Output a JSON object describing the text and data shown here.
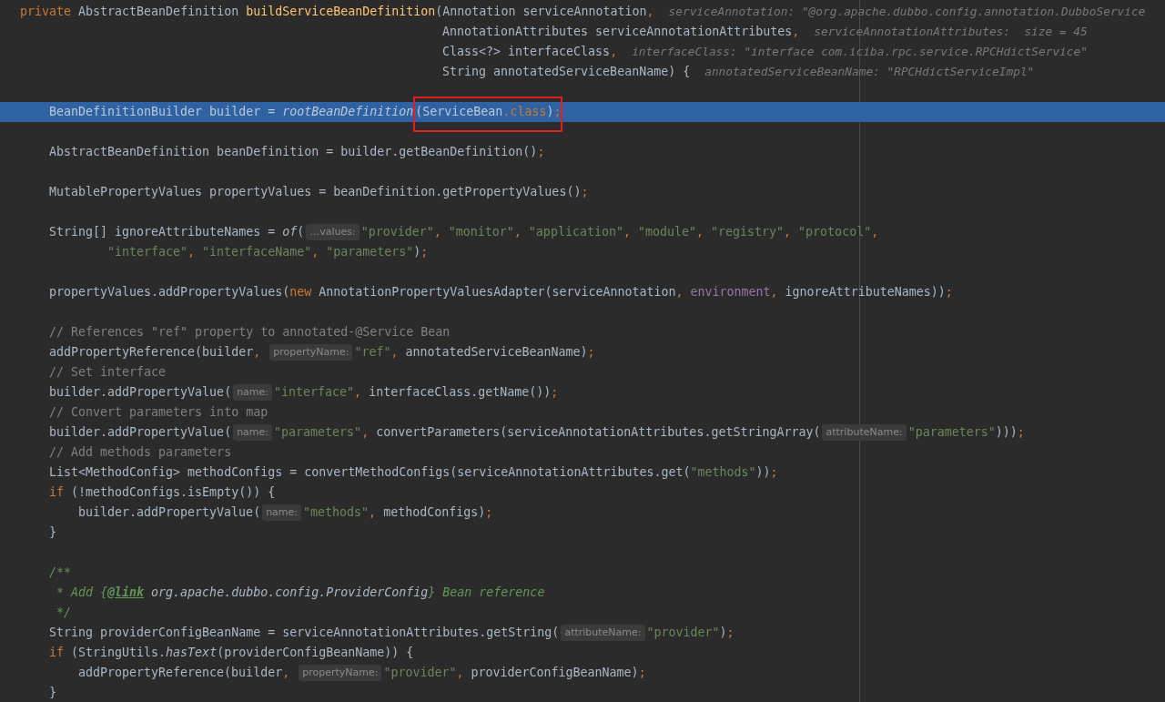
{
  "editor": {
    "lines": [
      {
        "highlighted": false,
        "kind": "signature",
        "tokens": [
          {
            "kind": "keyword",
            "text": "private"
          },
          {
            "kind": "text",
            "text": " AbstractBeanDefinition "
          },
          {
            "kind": "method",
            "text": "buildServiceBeanDefinition"
          },
          {
            "kind": "text",
            "text": "(Annotation serviceAnnotation"
          },
          {
            "kind": "punct",
            "text": ","
          },
          {
            "kind": "debug",
            "text": "serviceAnnotation: \"@org.apache.dubbo.config.annotation.DubboService"
          }
        ]
      },
      {
        "highlighted": false,
        "kind": "params",
        "tokens": [
          {
            "kind": "text",
            "text": "AnnotationAttributes serviceAnnotationAttributes"
          },
          {
            "kind": "punct",
            "text": ","
          },
          {
            "kind": "debug",
            "text": "serviceAnnotationAttributes:  size = 45"
          }
        ]
      },
      {
        "highlighted": false,
        "kind": "params",
        "tokens": [
          {
            "kind": "text",
            "text": "Class<?> interfaceClass"
          },
          {
            "kind": "punct",
            "text": ","
          },
          {
            "kind": "debug",
            "text": "interfaceClass: \"interface com.iciba.rpc.service.RPCHdictService\""
          }
        ]
      },
      {
        "highlighted": false,
        "kind": "params",
        "tokens": [
          {
            "kind": "text",
            "text": "String annotatedServiceBeanName) {"
          },
          {
            "kind": "debug",
            "text": "annotatedServiceBeanName: \"RPCHdictServiceImpl\""
          }
        ]
      },
      {
        "highlighted": false
      },
      {
        "highlighted": true,
        "kind": "body",
        "tokens": [
          {
            "kind": "text",
            "text": "BeanDefinitionBuilder builder = "
          },
          {
            "kind": "static",
            "text": "rootBeanDefinition"
          },
          {
            "kind": "group",
            "boxed": true,
            "tokens": [
              {
                "kind": "text",
                "text": "(ServiceBean"
              },
              {
                "kind": "keyword",
                "text": ".class"
              },
              {
                "kind": "text",
                "text": ")"
              },
              {
                "kind": "punct",
                "text": ";"
              }
            ]
          }
        ]
      },
      {
        "highlighted": false
      },
      {
        "highlighted": false,
        "kind": "body",
        "tokens": [
          {
            "kind": "text",
            "text": "AbstractBeanDefinition beanDefinition = builder.getBeanDefinition()"
          },
          {
            "kind": "punct",
            "text": ";"
          }
        ]
      },
      {
        "highlighted": false
      },
      {
        "highlighted": false,
        "kind": "body",
        "tokens": [
          {
            "kind": "text",
            "text": "MutablePropertyValues propertyValues = beanDefinition.getPropertyValues()"
          },
          {
            "kind": "punct",
            "text": ";"
          }
        ]
      },
      {
        "highlighted": false
      },
      {
        "highlighted": false,
        "kind": "body",
        "tokens": [
          {
            "kind": "text",
            "text": "String[] ignoreAttributeNames = "
          },
          {
            "kind": "static",
            "text": "of"
          },
          {
            "kind": "text",
            "text": "("
          },
          {
            "kind": "hint",
            "text": "…values:"
          },
          {
            "kind": "string",
            "text": "\"provider\""
          },
          {
            "kind": "punct",
            "text": ", "
          },
          {
            "kind": "string",
            "text": "\"monitor\""
          },
          {
            "kind": "punct",
            "text": ", "
          },
          {
            "kind": "string",
            "text": "\"application\""
          },
          {
            "kind": "punct",
            "text": ", "
          },
          {
            "kind": "string",
            "text": "\"module\""
          },
          {
            "kind": "punct",
            "text": ", "
          },
          {
            "kind": "string",
            "text": "\"registry\""
          },
          {
            "kind": "punct",
            "text": ", "
          },
          {
            "kind": "string",
            "text": "\"protocol\""
          },
          {
            "kind": "punct",
            "text": ","
          }
        ]
      },
      {
        "highlighted": false,
        "kind": "continuation",
        "tokens": [
          {
            "kind": "string",
            "text": "\"interface\""
          },
          {
            "kind": "punct",
            "text": ", "
          },
          {
            "kind": "string",
            "text": "\"interfaceName\""
          },
          {
            "kind": "punct",
            "text": ", "
          },
          {
            "kind": "string",
            "text": "\"parameters\""
          },
          {
            "kind": "text",
            "text": ")"
          },
          {
            "kind": "punct",
            "text": ";"
          }
        ]
      },
      {
        "highlighted": false
      },
      {
        "highlighted": false,
        "kind": "body",
        "tokens": [
          {
            "kind": "text",
            "text": "propertyValues.addPropertyValues("
          },
          {
            "kind": "keyword",
            "text": "new"
          },
          {
            "kind": "text",
            "text": " AnnotationPropertyValuesAdapter(serviceAnnotation"
          },
          {
            "kind": "punct",
            "text": ", "
          },
          {
            "kind": "field",
            "text": "environment"
          },
          {
            "kind": "punct",
            "text": ", "
          },
          {
            "kind": "text",
            "text": "ignoreAttributeNames))"
          },
          {
            "kind": "punct",
            "text": ";"
          }
        ]
      },
      {
        "highlighted": false
      },
      {
        "highlighted": false,
        "kind": "body",
        "tokens": [
          {
            "kind": "comment",
            "text": "// References \"ref\" property to annotated-@Service Bean"
          }
        ]
      },
      {
        "highlighted": false,
        "kind": "body",
        "tokens": [
          {
            "kind": "text",
            "text": "addPropertyReference(builder"
          },
          {
            "kind": "punct",
            "text": ", "
          },
          {
            "kind": "hint",
            "text": "propertyName:"
          },
          {
            "kind": "string",
            "text": "\"ref\""
          },
          {
            "kind": "punct",
            "text": ", "
          },
          {
            "kind": "text",
            "text": "annotatedServiceBeanName)"
          },
          {
            "kind": "punct",
            "text": ";"
          }
        ]
      },
      {
        "highlighted": false,
        "kind": "body",
        "tokens": [
          {
            "kind": "comment",
            "text": "// Set interface"
          }
        ]
      },
      {
        "highlighted": false,
        "kind": "body",
        "tokens": [
          {
            "kind": "text",
            "text": "builder.addPropertyValue("
          },
          {
            "kind": "hint",
            "text": "name:"
          },
          {
            "kind": "string",
            "text": "\"interface\""
          },
          {
            "kind": "punct",
            "text": ", "
          },
          {
            "kind": "text",
            "text": "interfaceClass.getName())"
          },
          {
            "kind": "punct",
            "text": ";"
          }
        ]
      },
      {
        "highlighted": false,
        "kind": "body",
        "tokens": [
          {
            "kind": "comment",
            "text": "// Convert parameters into map"
          }
        ]
      },
      {
        "highlighted": false,
        "kind": "body",
        "tokens": [
          {
            "kind": "text",
            "text": "builder.addPropertyValue("
          },
          {
            "kind": "hint",
            "text": "name:"
          },
          {
            "kind": "string",
            "text": "\"parameters\""
          },
          {
            "kind": "punct",
            "text": ", "
          },
          {
            "kind": "text",
            "text": "convertParameters(serviceAnnotationAttributes.getStringArray("
          },
          {
            "kind": "hint",
            "text": "attributeName:"
          },
          {
            "kind": "string",
            "text": "\"parameters\""
          },
          {
            "kind": "text",
            "text": ")))"
          },
          {
            "kind": "punct",
            "text": ";"
          }
        ]
      },
      {
        "highlighted": false,
        "kind": "body",
        "tokens": [
          {
            "kind": "comment",
            "text": "// Add methods parameters"
          }
        ]
      },
      {
        "highlighted": false,
        "kind": "body",
        "tokens": [
          {
            "kind": "text",
            "text": "List<MethodConfig> methodConfigs = convertMethodConfigs(serviceAnnotationAttributes.get("
          },
          {
            "kind": "string",
            "text": "\"methods\""
          },
          {
            "kind": "text",
            "text": "))"
          },
          {
            "kind": "punct",
            "text": ";"
          }
        ]
      },
      {
        "highlighted": false,
        "kind": "body",
        "tokens": [
          {
            "kind": "keyword",
            "text": "if"
          },
          {
            "kind": "text",
            "text": " (!methodConfigs.isEmpty()) {"
          }
        ]
      },
      {
        "highlighted": false,
        "kind": "block",
        "tokens": [
          {
            "kind": "text",
            "text": "builder.addPropertyValue("
          },
          {
            "kind": "hint",
            "text": "name:"
          },
          {
            "kind": "string",
            "text": "\"methods\""
          },
          {
            "kind": "punct",
            "text": ", "
          },
          {
            "kind": "text",
            "text": "methodConfigs)"
          },
          {
            "kind": "punct",
            "text": ";"
          }
        ]
      },
      {
        "highlighted": false,
        "kind": "body",
        "tokens": [
          {
            "kind": "text",
            "text": "}"
          }
        ]
      },
      {
        "highlighted": false
      },
      {
        "highlighted": false,
        "kind": "body",
        "tokens": [
          {
            "kind": "doc",
            "text": "/**"
          }
        ]
      },
      {
        "highlighted": false,
        "kind": "doc_body",
        "tokens": [
          {
            "kind": "doc",
            "text": "* Add {"
          },
          {
            "kind": "doc_tag",
            "text": "@link"
          },
          {
            "kind": "doc_ref",
            "text": "org.apache.dubbo.config.ProviderConfig"
          },
          {
            "kind": "doc",
            "text": "} Bean reference"
          }
        ]
      },
      {
        "highlighted": false,
        "kind": "doc_body",
        "tokens": [
          {
            "kind": "doc",
            "text": "*/"
          }
        ]
      },
      {
        "highlighted": false,
        "kind": "body",
        "tokens": [
          {
            "kind": "text",
            "text": "String providerConfigBeanName = serviceAnnotationAttributes.getString("
          },
          {
            "kind": "hint",
            "text": "attributeName:"
          },
          {
            "kind": "string",
            "text": "\"provider\""
          },
          {
            "kind": "text",
            "text": ")"
          },
          {
            "kind": "punct",
            "text": ";"
          }
        ]
      },
      {
        "highlighted": false,
        "kind": "body",
        "tokens": [
          {
            "kind": "keyword",
            "text": "if"
          },
          {
            "kind": "text",
            "text": " (StringUtils."
          },
          {
            "kind": "static",
            "text": "hasText"
          },
          {
            "kind": "text",
            "text": "(providerConfigBeanName)) {"
          }
        ]
      },
      {
        "highlighted": false,
        "kind": "block",
        "tokens": [
          {
            "kind": "text",
            "text": "addPropertyReference(builder"
          },
          {
            "kind": "punct",
            "text": ", "
          },
          {
            "kind": "hint",
            "text": "propertyName:"
          },
          {
            "kind": "string",
            "text": "\"provider\""
          },
          {
            "kind": "punct",
            "text": ", "
          },
          {
            "kind": "text",
            "text": "providerConfigBeanName)"
          },
          {
            "kind": "punct",
            "text": ";"
          }
        ]
      },
      {
        "highlighted": false,
        "kind": "body",
        "tokens": [
          {
            "kind": "text",
            "text": "}"
          }
        ]
      }
    ]
  }
}
